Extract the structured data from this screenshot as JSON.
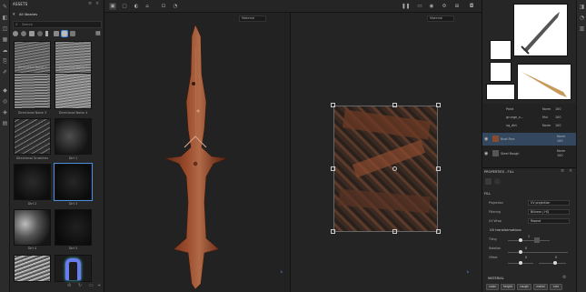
{
  "assets_panel": {
    "title": "ASSETS",
    "library_label": "All libraries",
    "search_placeholder": "Search",
    "thumbnails": [
      {
        "label": "Directional Noise 1"
      },
      {
        "label": "Directional Noise 2"
      },
      {
        "label": "Directional Noise 3"
      },
      {
        "label": "Directional Noise 4"
      },
      {
        "label": "Directional Scratches"
      },
      {
        "label": "Dirt 1"
      },
      {
        "label": "Dirt 2"
      },
      {
        "label": "Dirt 3"
      },
      {
        "label": "Dirt 4"
      },
      {
        "label": "Dirt 5"
      },
      {
        "label": ""
      },
      {
        "label": ""
      }
    ]
  },
  "viewport_3d": {
    "mode_label": "Material"
  },
  "viewport_2d": {
    "mode_label": "Material"
  },
  "layers": [
    {
      "name": "Paint",
      "blend": "Norm",
      "opacity": "100"
    },
    {
      "name": "grunge_n...",
      "blend": "Mul",
      "opacity": "100"
    },
    {
      "name": "ng_dirt",
      "blend": "Norm",
      "opacity": "100"
    },
    {
      "name": "Rust Fine",
      "blend": "Norm",
      "opacity": "100"
    },
    {
      "name": "Steel Rough",
      "blend": "Norm",
      "opacity": "100"
    }
  ],
  "properties": {
    "title": "PROPERTIES - FILL",
    "section_fill": "FILL",
    "projection_label": "Projection",
    "projection_value": "UV projection",
    "filtering_label": "Filtering",
    "filtering_value": "Bilinear | HQ",
    "uvwrap_label": "UV Wrap",
    "uvwrap_value": "Repeat",
    "uv_section": "UV transformations",
    "tiling_label": "Tiling",
    "tiling_value": "1",
    "rotation_label": "Rotation",
    "rotation_value": "0",
    "offset_label": "Offset",
    "offset_x": "0",
    "offset_y": "0",
    "material_section": "MATERIAL",
    "channels": [
      "color",
      "height",
      "rough",
      "metal",
      "nrm"
    ]
  }
}
